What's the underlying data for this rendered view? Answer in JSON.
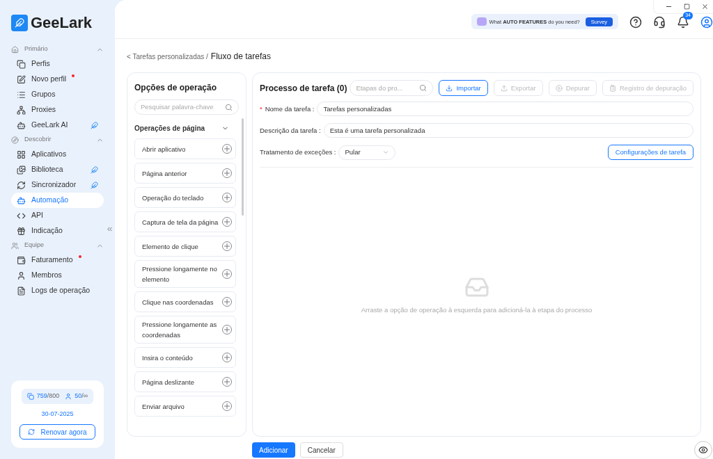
{
  "logo": {
    "text": "GeeLark"
  },
  "sidebar": {
    "sections": [
      {
        "title": "Primário",
        "expanded": true,
        "items": [
          {
            "label": "Perfis",
            "selected": false,
            "dot": false,
            "ai_tag": false
          },
          {
            "label": "Novo perfil",
            "selected": false,
            "dot": true,
            "ai_tag": false
          },
          {
            "label": "Grupos",
            "selected": false,
            "dot": false,
            "ai_tag": false
          },
          {
            "label": "Proxies",
            "selected": false,
            "dot": false,
            "ai_tag": false
          },
          {
            "label": "GeeLark AI",
            "selected": false,
            "dot": false,
            "ai_tag": true
          }
        ]
      },
      {
        "title": "Descobrir",
        "expanded": true,
        "items": [
          {
            "label": "Aplicativos",
            "selected": false,
            "dot": false,
            "ai_tag": false
          },
          {
            "label": "Biblioteca",
            "selected": false,
            "dot": false,
            "ai_tag": true
          },
          {
            "label": "Sincronizador",
            "selected": false,
            "dot": false,
            "ai_tag": true
          },
          {
            "label": "Automação",
            "selected": true,
            "dot": false,
            "ai_tag": false
          },
          {
            "label": "API",
            "selected": false,
            "dot": false,
            "ai_tag": false
          },
          {
            "label": "Indicação",
            "selected": false,
            "dot": false,
            "ai_tag": false
          }
        ]
      },
      {
        "title": "Equipe",
        "expanded": true,
        "items": [
          {
            "label": "Faturamento",
            "selected": false,
            "dot": true,
            "ai_tag": false
          },
          {
            "label": "Membros",
            "selected": false,
            "dot": false,
            "ai_tag": false
          },
          {
            "label": "Logs de operação",
            "selected": false,
            "dot": false,
            "ai_tag": false
          }
        ]
      }
    ],
    "plan": {
      "profiles": "759",
      "profiles_total": "/800",
      "members": "50",
      "members_total": "/∞",
      "date": "30-07-2025",
      "renew": "Renovar agora"
    }
  },
  "topbar": {
    "survey_prefix": "What",
    "survey_bold": "AUTO FEATURES",
    "survey_suffix": "do you need?",
    "survey_button": "Survey",
    "notifications": "34"
  },
  "breadcrumb": {
    "parent": "< Tarefas personalizadas /",
    "current": "Fluxo de tarefas"
  },
  "options_panel": {
    "title": "Opções de operação",
    "search_placeholder": "Pesquisar palavra-chave",
    "group": {
      "title": "Operações de página",
      "expanded": true,
      "items": [
        "Abrir aplicativo",
        "Página anterior",
        "Operação do teclado",
        "Captura de tela da página",
        "Elemento de clique",
        "Pressione longamente no elemento",
        "Clique nas coordenadas",
        "Pressione longamente as coordenadas",
        "Insira o conteúdo",
        "Página deslizante",
        "Enviar arquivo"
      ]
    }
  },
  "process_panel": {
    "title": "Processo de tarefa (0)",
    "search_placeholder": "Etapas do pro...",
    "toolbar": [
      {
        "label": "Importar",
        "disabled": false
      },
      {
        "label": "Exportar",
        "disabled": true
      },
      {
        "label": "Depurar",
        "disabled": true
      },
      {
        "label": "Registro de depuração",
        "disabled": true
      }
    ],
    "name_label": "Nome da tarefa :",
    "name_value": "Tarefas personalizadas",
    "name_required_mark": "*",
    "desc_label": "Descrição da tarefa :",
    "desc_value": "Esta é uma tarefa personalizada",
    "exc_label": "Tratamento de exceções :",
    "exc_value": "Pular",
    "settings_button": "Configurações de tarefa",
    "empty_text": "Arraste a opção de operação à esquerda para adicioná-la à etapa do processo"
  },
  "footer_buttons": [
    {
      "label": "Adicionar",
      "primary": true
    },
    {
      "label": "Cancelar",
      "primary": false
    }
  ]
}
